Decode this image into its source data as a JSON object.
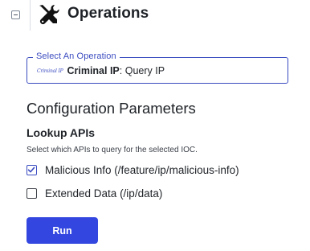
{
  "header": {
    "title": "Operations",
    "collapse_icon": "minus-square-icon",
    "tools_icon": "wrench-screwdriver-icon"
  },
  "operation": {
    "legend": "Select An Operation",
    "vendor_logo_text": "Criminal IP",
    "vendor": "Criminal IP",
    "separator": ":",
    "action": "Query IP",
    "accent_color": "#3b4cc0"
  },
  "config": {
    "title": "Configuration Parameters",
    "lookup_title": "Lookup APIs",
    "lookup_description": "Select which APIs to query for the selected IOC.",
    "options": [
      {
        "label": "Malicious Info (/feature/ip/malicious-info)",
        "checked": true
      },
      {
        "label": "Extended Data (/ip/data)",
        "checked": false
      }
    ]
  },
  "run_button": {
    "label": "Run",
    "color": "#3347e0"
  }
}
